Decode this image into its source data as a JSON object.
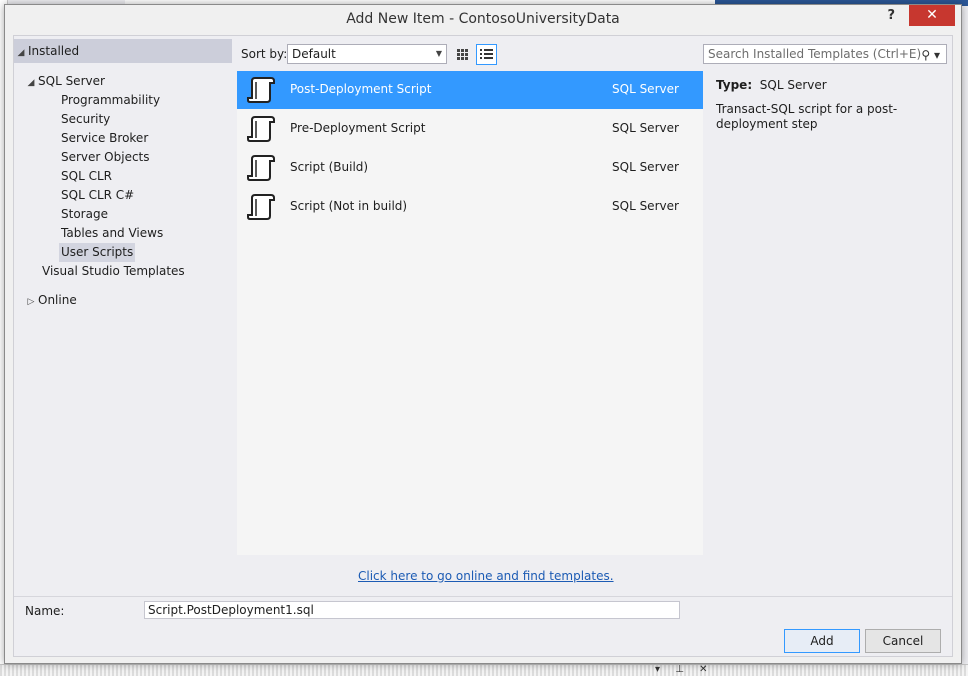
{
  "dialog": {
    "title": "Add New Item - ContosoUniversityData",
    "help_glyph": "?",
    "close_glyph": "✕"
  },
  "tree": {
    "installed": "Installed",
    "sql_server": "SQL Server",
    "children": [
      "Programmability",
      "Security",
      "Service Broker",
      "Server Objects",
      "SQL CLR",
      "SQL CLR C#",
      "Storage",
      "Tables and Views",
      "User Scripts"
    ],
    "selected": "User Scripts",
    "vs_templates": "Visual Studio Templates",
    "online": "Online"
  },
  "toolbar": {
    "sort_label": "Sort by:",
    "sort_value": "Default",
    "search_placeholder": "Search Installed Templates (Ctrl+E)"
  },
  "templates": [
    {
      "name": "Post-Deployment Script",
      "category": "SQL Server",
      "selected": true
    },
    {
      "name": "Pre-Deployment Script",
      "category": "SQL Server",
      "selected": false
    },
    {
      "name": "Script (Build)",
      "category": "SQL Server",
      "selected": false
    },
    {
      "name": "Script (Not in build)",
      "category": "SQL Server",
      "selected": false
    }
  ],
  "details": {
    "type_label": "Type:",
    "type_value": "SQL Server",
    "description": "Transact-SQL script for a post-deployment step"
  },
  "online_link": "Click here to go online and find templates.",
  "name_field": {
    "label": "Name:",
    "value": "Script.PostDeployment1.sql"
  },
  "buttons": {
    "add": "Add",
    "cancel": "Cancel"
  },
  "colors": {
    "selection": "#3399ff",
    "link": "#1c5bb4",
    "close": "#c7372f"
  }
}
